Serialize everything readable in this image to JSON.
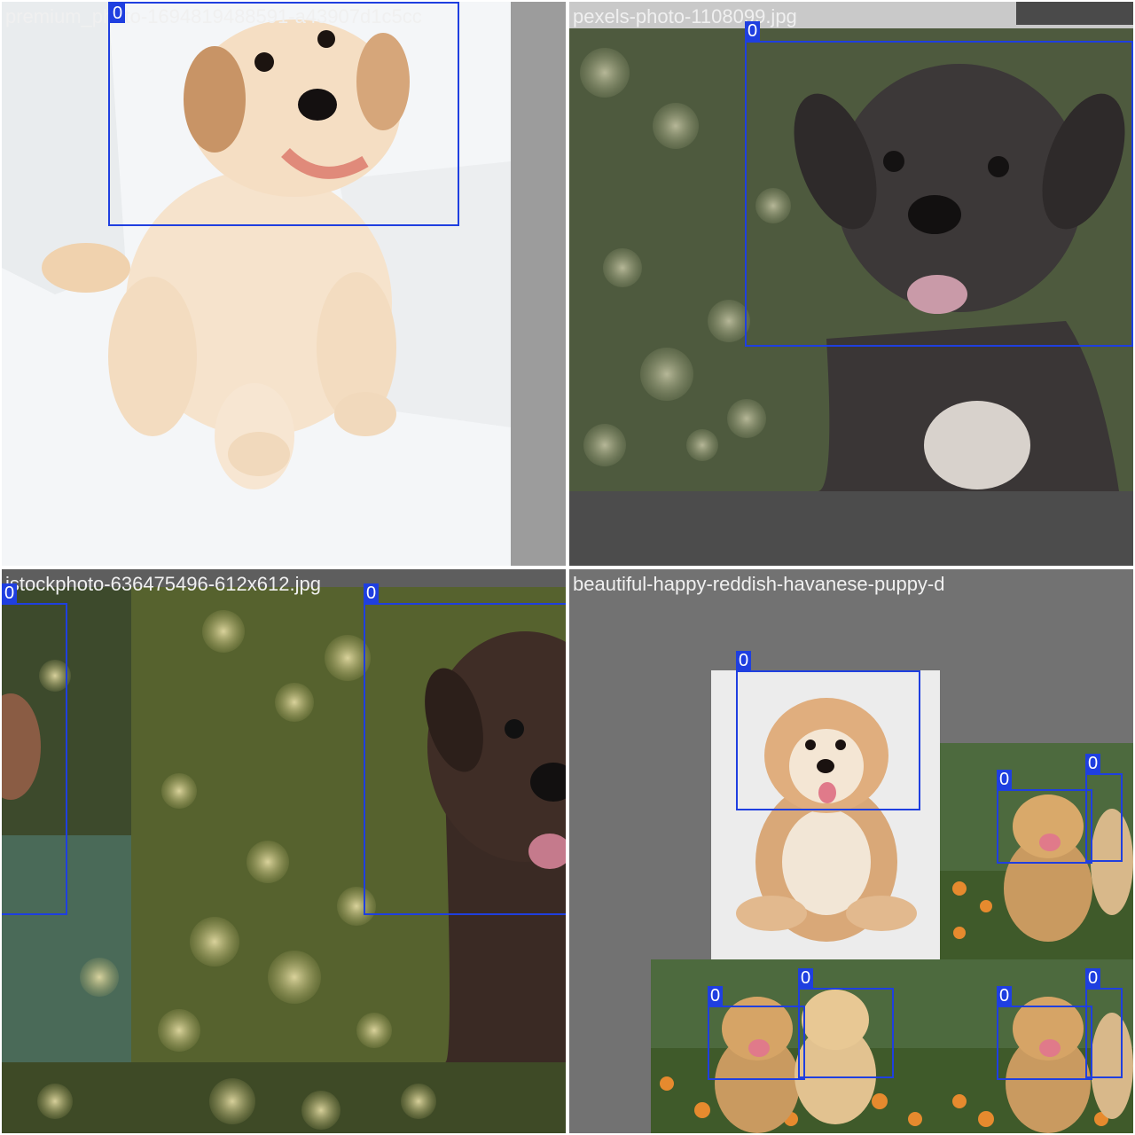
{
  "colors": {
    "box": "#1f3fe0",
    "label_text": "#ffffff",
    "filename_text": "#f0f0f0",
    "pad_gray": "#727272"
  },
  "tiles": [
    {
      "filename": "premium_photo-1694819488591-a43907d1c5cc",
      "boxes": [
        {
          "label": "0"
        }
      ]
    },
    {
      "filename": "pexels-photo-1108099.jpg",
      "boxes": [
        {
          "label": "0"
        }
      ]
    },
    {
      "filename": "istockphoto-636475496-612x612.jpg",
      "boxes": [
        {
          "label": "0"
        },
        {
          "label": "0"
        }
      ]
    },
    {
      "filename": "beautiful-happy-reddish-havanese-puppy-d",
      "boxes": [
        {
          "label": "0"
        },
        {
          "label": "0"
        },
        {
          "label": "0"
        },
        {
          "label": "0"
        },
        {
          "label": "0"
        },
        {
          "label": "0"
        },
        {
          "label": "0"
        },
        {
          "label": "0"
        }
      ]
    }
  ]
}
